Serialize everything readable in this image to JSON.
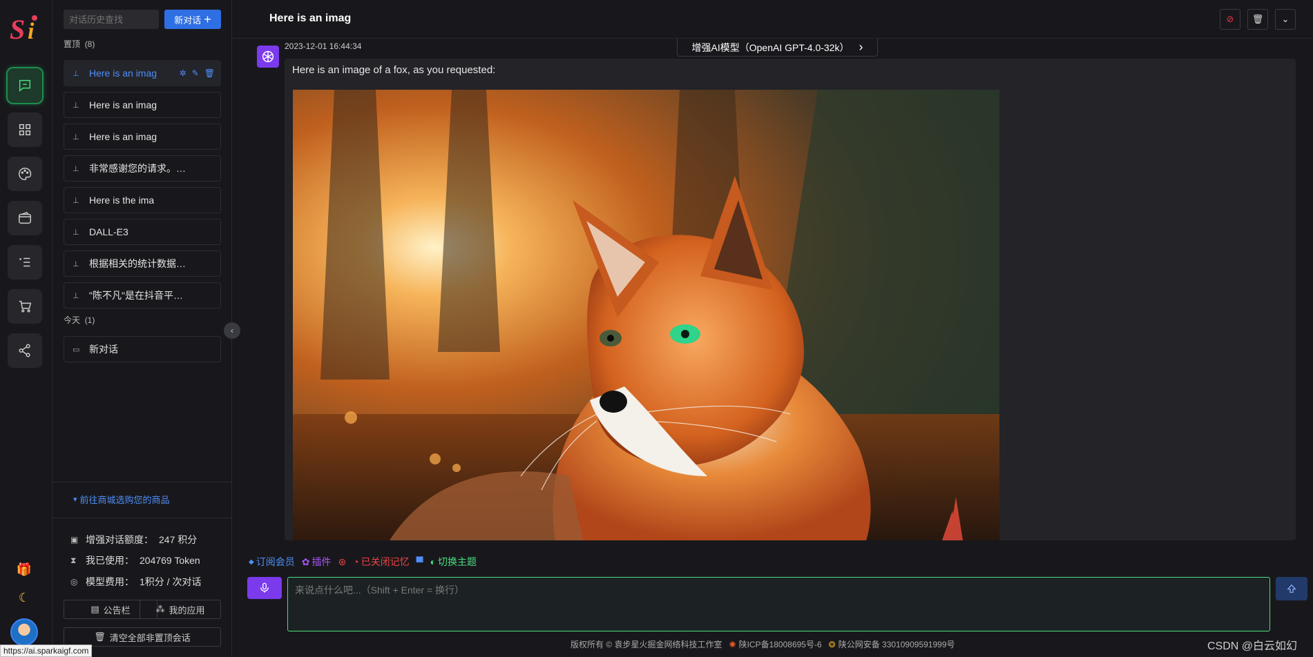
{
  "rail": {
    "logo_text": "Si",
    "items": [
      "chat-icon",
      "apps-icon",
      "palette-icon",
      "wallet-icon",
      "list-icon",
      "cart-icon",
      "share-icon"
    ]
  },
  "sidebar": {
    "search_placeholder": "对话历史查找",
    "new_chat_label": "新对话",
    "pinned_label": "置顶",
    "pinned_count": "(8)",
    "pinned": [
      "Here is an imag",
      "Here is an imag",
      "Here is an imag",
      "非常感谢您的请求。作为...",
      "Here is the ima",
      "DALL-E3",
      "根据相关的统计数据，以...",
      "\"陈不凡\"是在抖音平台上..."
    ],
    "today_label": "今天",
    "today_count": "(1)",
    "today": [
      "新对话"
    ],
    "shop_link": "前往商城选购您的商品",
    "stats": {
      "quota_label": "增强对话额度：",
      "quota_value": "247 积分",
      "used_label": "我已使用：",
      "used_value": "204769 Token",
      "cost_label": "模型费用：",
      "cost_value": "1积分 / 次对话"
    },
    "notice_label": "公告栏",
    "my_apps_label": "我的应用",
    "clear_label": "清空全部非置顶会话"
  },
  "header": {
    "title": "Here is an imag",
    "model_label": "增强AI模型（OpenAI GPT-4.0-32k）"
  },
  "message": {
    "time": "2023-12-01 16:44:34",
    "text": "Here is an image of a fox, as you requested:"
  },
  "toolbar": {
    "subscribe": "订阅会员",
    "plugins": "插件",
    "memory": "已关闭记忆",
    "theme": "切换主题"
  },
  "input": {
    "placeholder": "来说点什么吧...（Shift + Enter = 换行）"
  },
  "footer": {
    "copyright": "版权所有 © 袁步星火掘金网络科技工作室",
    "icp": "陕ICP备18008695号-6",
    "police": "陕公网安备 33010909591999号"
  },
  "watermark": "CSDN @白云如幻",
  "status_url": "https://ai.sparkaigf.com",
  "colors": {
    "accent": "#2f6fe4",
    "link": "#4f8ef7",
    "active_green": "#4ade80",
    "purple": "#7c3aed"
  }
}
